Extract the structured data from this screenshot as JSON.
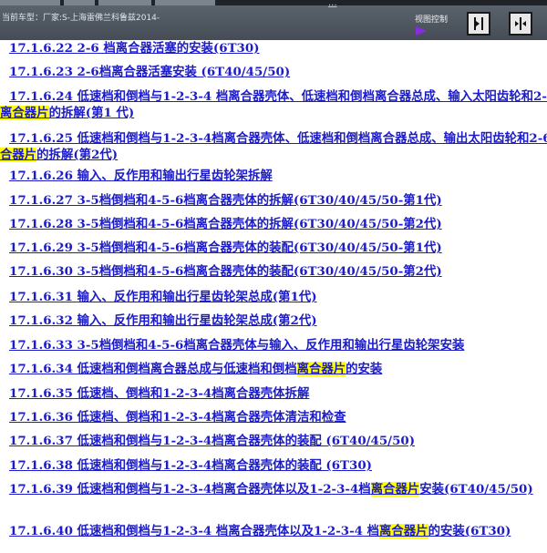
{
  "topbar": {
    "model_label": "当前车型：厂家:S-上海雷佛兰科鲁兹2014-",
    "ellipsis": "...",
    "view_control": "视图控制",
    "colors": {
      "bar": "#4f5761",
      "arrow": "#8a2be2",
      "link": "#1c1cc8",
      "highlight": "#ffff00"
    },
    "buttons": [
      {
        "icon": "panel-right-icon"
      },
      {
        "icon": "split-arrows-icon"
      }
    ]
  },
  "items": [
    {
      "text": "17.1.6.22 2-6 档离合器活塞的安装(6T30)"
    },
    {
      "text": "17.1.6.23 2-6档离合器活塞安装 (6T40/45/50)"
    },
    {
      "pre": "17.1.6.24 低速档和倒档与1-2-3-4 档离合器壳体、低速档和倒档离合器总成、输入太阳齿轮和2-6 档",
      "hl": "离合器片",
      "post": "的拆解(第1 代)"
    },
    {
      "pre": "17.1.6.25 低速档和倒档与1-2-3-4档离合器壳体、低速档和倒档离合器总成、输出太阳齿轮和2-6档",
      "hl": "离合器片",
      "post": "的拆解(第2代)"
    },
    {
      "text": "17.1.6.26 输入、反作用和输出行星齿轮架拆解"
    },
    {
      "text": "17.1.6.27 3-5档倒档和4-5-6档离合器壳体的拆解(6T30/40/45/50-第1代)"
    },
    {
      "text": "17.1.6.28 3-5档倒档和4-5-6档离合器壳体的拆解(6T30/40/45/50-第2代)"
    },
    {
      "text": "17.1.6.29 3-5档倒档和4-5-6档离合器壳体的装配(6T30/40/45/50-第1代)"
    },
    {
      "text": "17.1.6.30 3-5档倒档和4-5-6档离合器壳体的装配(6T30/40/45/50-第2代)"
    },
    {
      "text": "17.1.6.31 输入、反作用和输出行星齿轮架总成(第1代)"
    },
    {
      "text": "17.1.6.32 输入、反作用和输出行星齿轮架总成(第2代)"
    },
    {
      "text": "17.1.6.33 3-5档倒档和4-5-6档离合器壳体与输入、反作用和输出行星齿轮架安装"
    },
    {
      "pre": "17.1.6.34 低速档和倒档离合器总成与低速档和倒档",
      "hl": "离合器片",
      "post": "的安装"
    },
    {
      "text": "17.1.6.35 低速档、倒档和1-2-3-4档离合器壳体拆解"
    },
    {
      "text": "17.1.6.36 低速档、倒档和1-2-3-4档离合器壳体清洁和检查"
    },
    {
      "text": "17.1.6.37 低速档和倒档与1-2-3-4档离合器壳体的装配 (6T40/45/50)"
    },
    {
      "text": "17.1.6.38 低速档和倒档与1-2-3-4档离合器壳体的装配 (6T30)"
    },
    {
      "pre": "17.1.6.39 低速档和倒档与1-2-3-4档离合器壳体以及1-2-3-4档",
      "hl": "离合器片",
      "post": "安装(6T40/45/50)"
    },
    {
      "pre": "17.1.6.40 低速档和倒档与1-2-3-4 档离合器壳体以及1-2-3-4 档",
      "hl": "离合器片",
      "post": "的安装(6T30)"
    }
  ]
}
